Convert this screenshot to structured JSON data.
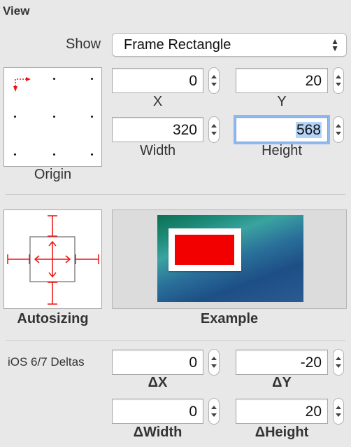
{
  "view": {
    "section_title": "View",
    "show_label": "Show",
    "show_value": "Frame Rectangle",
    "origin_label": "Origin",
    "x": {
      "value": "0",
      "label": "X"
    },
    "y": {
      "value": "20",
      "label": "Y"
    },
    "width": {
      "value": "320",
      "label": "Width"
    },
    "height": {
      "value": "568",
      "label": "Height"
    }
  },
  "autosizing": {
    "label": "Autosizing",
    "example_label": "Example",
    "accent_color": "#ee1111"
  },
  "deltas": {
    "title": "iOS 6/7 Deltas",
    "dx": {
      "value": "0",
      "label": "ΔX"
    },
    "dy": {
      "value": "-20",
      "label": "ΔY"
    },
    "dwidth": {
      "value": "0",
      "label": "ΔWidth"
    },
    "dheight": {
      "value": "20",
      "label": "ΔHeight"
    }
  }
}
